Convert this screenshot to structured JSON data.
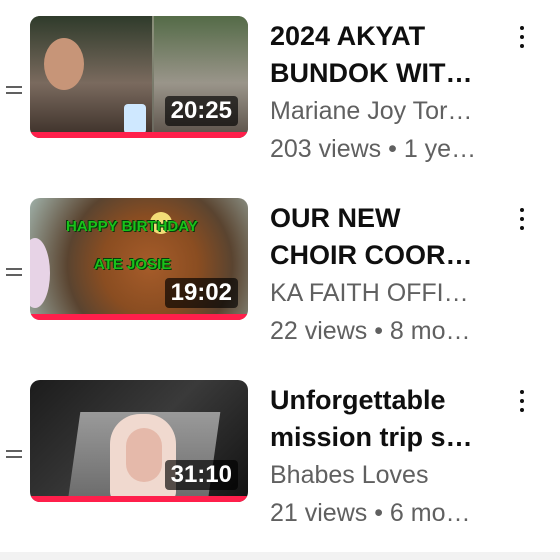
{
  "videos": [
    {
      "title_line1": "2024 AKYAT",
      "title_line2": "BUNDOK WIT…",
      "channel": "Mariane Joy Tor…",
      "meta": "203 views • 1 ye…",
      "duration": "20:25",
      "thumb_text": []
    },
    {
      "title_line1": "OUR NEW",
      "title_line2": "CHOIR COOR…",
      "channel": "KA FAITH OFFI…",
      "meta": "22 views • 8 mo…",
      "duration": "19:02",
      "thumb_text": [
        "HAPPY BIRTHDAY",
        "ATE JOSIE"
      ]
    },
    {
      "title_line1": "Unforgettable",
      "title_line2": "mission trip s…",
      "channel": "Bhabes Loves",
      "meta": "21 views • 6 mo…",
      "duration": "31:10",
      "thumb_text": []
    }
  ],
  "icons": {
    "drag": "drag-handle-icon",
    "menu": "more-vert-icon"
  },
  "colors": {
    "title": "#0f0f0f",
    "secondary": "#606060",
    "progress": "#ff1f4b",
    "thumb_text": "#19c21a"
  }
}
